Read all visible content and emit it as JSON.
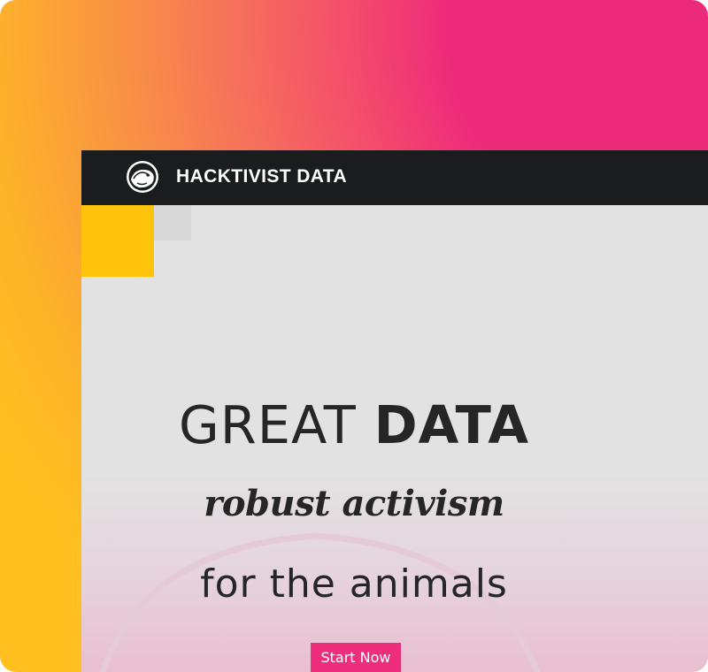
{
  "header": {
    "brand_name": "HACKTIVIST DATA",
    "logo_icon": "hedgehog-logo-icon"
  },
  "hero": {
    "line1_light": "GREAT",
    "line1_bold": "DATA",
    "line2": "robust activism",
    "line3": "for the animals",
    "cta_label": "Start Now"
  },
  "colors": {
    "accent_pink": "#ee2d7d",
    "accent_yellow": "#ffc30b",
    "topbar": "#1a1c1d",
    "background_gradient": [
      "#ffc01f",
      "#f99344",
      "#ee2a7b"
    ]
  }
}
